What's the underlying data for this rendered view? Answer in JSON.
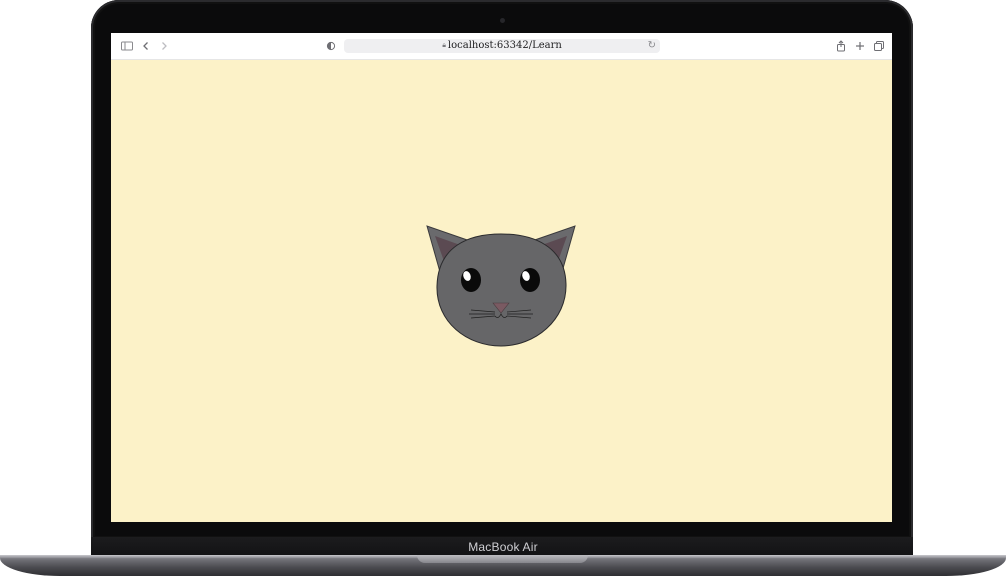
{
  "browser": {
    "url": "localhost:63342/Learn",
    "icons": {
      "sidebar": "sidebar-icon",
      "back": "back-chevron-icon",
      "forward": "forward-chevron-icon",
      "privacy": "privacy-shield-icon",
      "lock": "lock-icon",
      "reload": "reload-icon",
      "share": "share-icon",
      "new_tab": "plus-icon",
      "tabs": "tab-overview-icon"
    }
  },
  "page": {
    "background_color": "#fcf2c8",
    "illustration": "cat-face"
  },
  "device": {
    "label": "MacBook Air"
  }
}
